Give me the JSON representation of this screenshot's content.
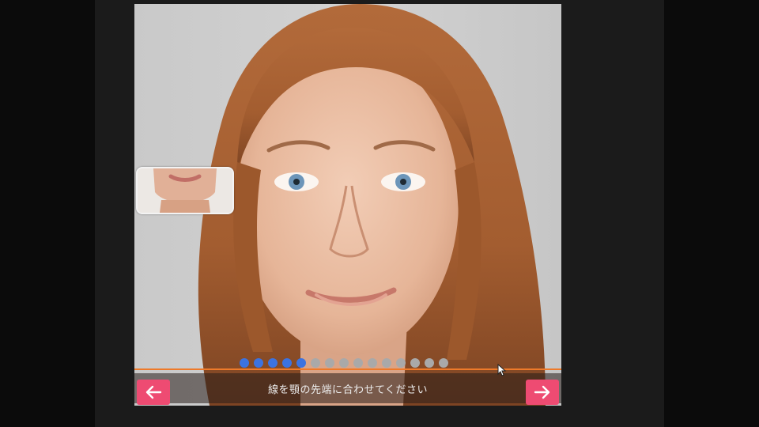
{
  "instruction": {
    "text": "線を顎の先端に合わせてください"
  },
  "progress": {
    "total_steps": 15,
    "completed_steps": 5
  },
  "icons": {
    "prev": "arrow-left-icon",
    "next": "arrow-right-icon"
  },
  "colors": {
    "accent_button": "#ee4b72",
    "guide_line": "#ee7a2a",
    "dot_active": "#3c73e0",
    "dot_inactive": "#a9a9a9"
  }
}
